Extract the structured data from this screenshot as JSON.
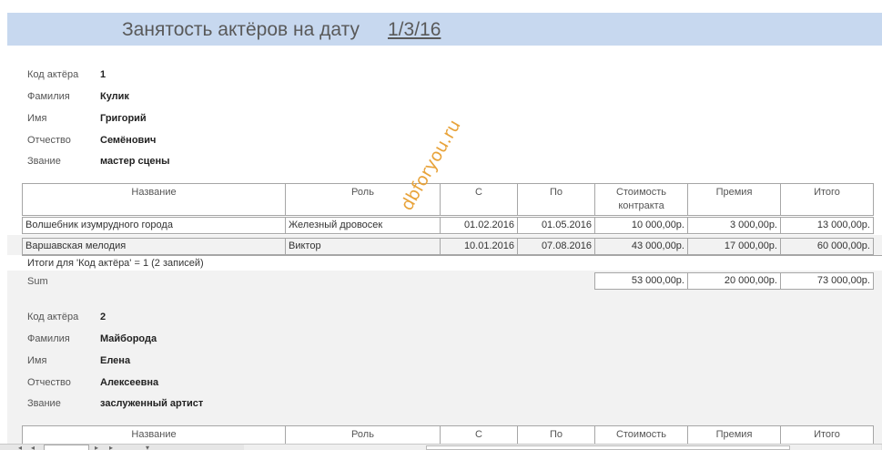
{
  "report": {
    "title": "Занятость актёров на дату",
    "date": "1/3/16"
  },
  "labels": {
    "actor_code": "Код актёра",
    "last_name": "Фамилия",
    "first_name": "Имя",
    "patronymic": "Отчество",
    "rank": "Звание"
  },
  "columns": {
    "name": "Название",
    "role": "Роль",
    "from": "С",
    "to": "По",
    "cost": "Стоимость контракта",
    "cost_short": "Стоимость",
    "bonus": "Премия",
    "total": "Итого"
  },
  "actor1": {
    "code": "1",
    "last_name": "Кулик",
    "first_name": "Григорий",
    "patronymic": "Семёнович",
    "rank": "мастер сцены",
    "rows": [
      {
        "name": "Волшебник изумрудного города",
        "role": "Железный дровосек",
        "from": "01.02.2016",
        "to": "01.05.2016",
        "cost": "10 000,00р.",
        "bonus": "3 000,00р.",
        "total": "13 000,00р."
      },
      {
        "name": "Варшавская мелодия",
        "role": "Виктор",
        "from": "10.01.2016",
        "to": "07.08.2016",
        "cost": "43 000,00р.",
        "bonus": "17 000,00р.",
        "total": "60 000,00р."
      }
    ],
    "summary": "Итоги для 'Код актёра' =  1 (2 записей)",
    "sum_label": "Sum",
    "sum": {
      "cost": "53 000,00р.",
      "bonus": "20 000,00р.",
      "total": "73 000,00р."
    }
  },
  "actor2": {
    "code": "2",
    "last_name": "Майборода",
    "first_name": "Елена",
    "patronymic": "Алексеевна",
    "rank": "заслуженный артист"
  },
  "watermark": "dbforyou.ru",
  "colors": {
    "title_band": "#c7d8ef",
    "grey_band": "#f2f2f2",
    "watermark": "#e8a33a"
  }
}
